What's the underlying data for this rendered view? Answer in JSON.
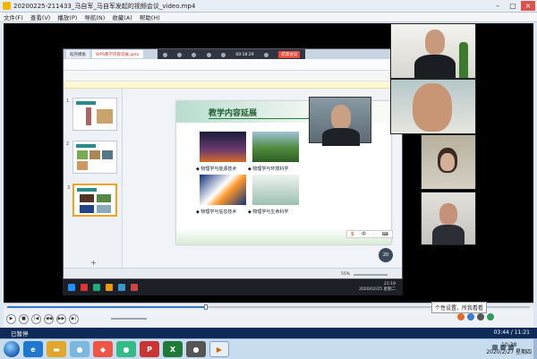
{
  "window": {
    "title": "20200225-211433_马自军_马自军发起的视频会议_video.mp4",
    "controls": {
      "minimize": "–",
      "maximize": "□",
      "close": "×"
    }
  },
  "menu": [
    "文件(F)",
    "查看(V)",
    "播放(P)",
    "导航(N)",
    "收藏(A)",
    "帮助(H)"
  ],
  "shared_screen": {
    "browser_tabs": [
      "稻壳模板",
      "WPS教学内容延展.pptx"
    ],
    "meeting_time": "00:18:29",
    "meeting_end_label": "结束会议",
    "slide": {
      "title": "教学内容延展",
      "captions": [
        "◆ 物理学与能源技术",
        "◆ 物理学与环境科学",
        "◆ 物理学与信息技术",
        "◆ 物理学与生命科学"
      ]
    },
    "thumb_numbers": [
      "1",
      "2",
      "3"
    ],
    "status_zoom": "55%",
    "participant_count": "20",
    "clock_time": "21:19",
    "clock_date": "2020/02/25 星期二"
  },
  "player": {
    "progress_fraction": 0.38,
    "tooltip": "个性设置，所我看看",
    "buttons": [
      "▶",
      "■",
      "|◀",
      "◀◀",
      "▶▶",
      "▶|"
    ],
    "state": "已暂停",
    "time": "03:44 / 11:21"
  },
  "taskbar": {
    "clock_time": "10:38",
    "clock_date": "2020/2/27 星期四"
  },
  "colors": {
    "accent": "#3878c8",
    "status_bar": "#0e2a58",
    "meeting_end": "#e84b3c"
  }
}
